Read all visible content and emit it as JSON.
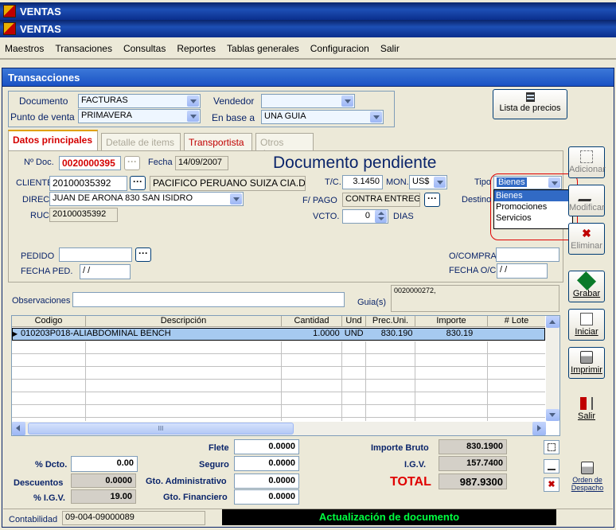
{
  "window": {
    "title_back": "VENTAS",
    "title_front": "VENTAS"
  },
  "menu": [
    "Maestros",
    "Transaciones",
    "Consultas",
    "Reportes",
    "Tablas generales",
    "Configuracion",
    "Salir"
  ],
  "form_title": "Transacciones",
  "header": {
    "documento_label": "Documento",
    "documento_value": "FACTURAS",
    "punto_label": "Punto de venta",
    "punto_value": "PRIMAVERA",
    "vendedor_label": "Vendedor",
    "vendedor_value": "",
    "base_label": "En base a",
    "base_value": "UNA GUIA",
    "lista_precios": "Lista de precios"
  },
  "tabs": [
    "Datos principales",
    "Detalle de items",
    "Transportista",
    "Otros datos"
  ],
  "doc": {
    "ndoc_label": "Nº Doc.",
    "ndoc_value": "0020000395",
    "fecha_label": "Fecha",
    "fecha_value": "14/09/2007",
    "status": "Documento pendiente",
    "cliente_label": "CLIENTE",
    "cliente_ruc": "20100035392",
    "cliente_name": "PACIFICO PERUANO SUIZA CIA.DE",
    "tc_label": "T/C.",
    "tc_value": "3.1450",
    "mon_label": "MON.",
    "mon_value": "US$",
    "tipo_label": "Tipo",
    "tipo_value": "Bienes",
    "tipo_options": [
      "Bienes",
      "Promociones",
      "Servicios"
    ],
    "direc_label": "DIREC.",
    "direc_value": "JUAN DE ARONA  830 SAN ISIDRO",
    "fpago_label": "F/ PAGO",
    "fpago_value": "CONTRA ENTREGA",
    "destino_label": "Destino",
    "ruc_label": "RUC",
    "ruc_value": "20100035392",
    "vcto_label": "VCTO.",
    "vcto_value": "0",
    "dias_label": "DIAS",
    "pedido_label": "PEDIDO",
    "fecha_ped_label": "FECHA PED.",
    "fecha_ped_value": " / /",
    "ocompra_label": "O/COMPRA",
    "fecha_oc_label": "FECHA O/C",
    "fecha_oc_value": " / /",
    "obs_label": "Observaciones",
    "guias_label": "Guia(s)",
    "guias_value": "0020000272,"
  },
  "grid": {
    "columns": [
      "Codigo",
      "Descripción",
      "Cantidad",
      "Und",
      "Prec.Uni.",
      "Importe",
      "# Lote"
    ],
    "rows": [
      {
        "codigo": "010203P018-ALI",
        "descripcion": "ABDOMINAL BENCH",
        "cantidad": "1.0000",
        "und": "UND",
        "prec": "830.190",
        "importe": "830.19",
        "lote": ""
      }
    ],
    "hscroll_glyph": "III"
  },
  "side_buttons": [
    "Adicionar",
    "Modificar",
    "Eliminar",
    "Grabar",
    "Iniciar",
    "Imprimir",
    "Salir",
    "Orden de Despacho"
  ],
  "totals": {
    "flete_label": "Flete",
    "flete": "0.0000",
    "seguro_label": "Seguro",
    "seguro": "0.0000",
    "gto_adm_label": "Gto. Administrativo",
    "gto_adm": "0.0000",
    "gto_fin_label": "Gto. Financiero",
    "gto_fin": "0.0000",
    "dcto_label": "% Dcto.",
    "dcto": "0.00",
    "descuentos_label": "Descuentos",
    "descuentos": "0.0000",
    "igv_pct_label": "% I.G.V.",
    "igv_pct": "19.00",
    "bruto_label": "Importe Bruto",
    "bruto": "830.1900",
    "igv_label": "I.G.V.",
    "igv": "157.7400",
    "total_label": "TOTAL",
    "total": "987.9300"
  },
  "status_bar": {
    "contabilidad_label": "Contabilidad",
    "contabilidad_value": "09-004-09000089",
    "message": "Actualización de documento"
  }
}
